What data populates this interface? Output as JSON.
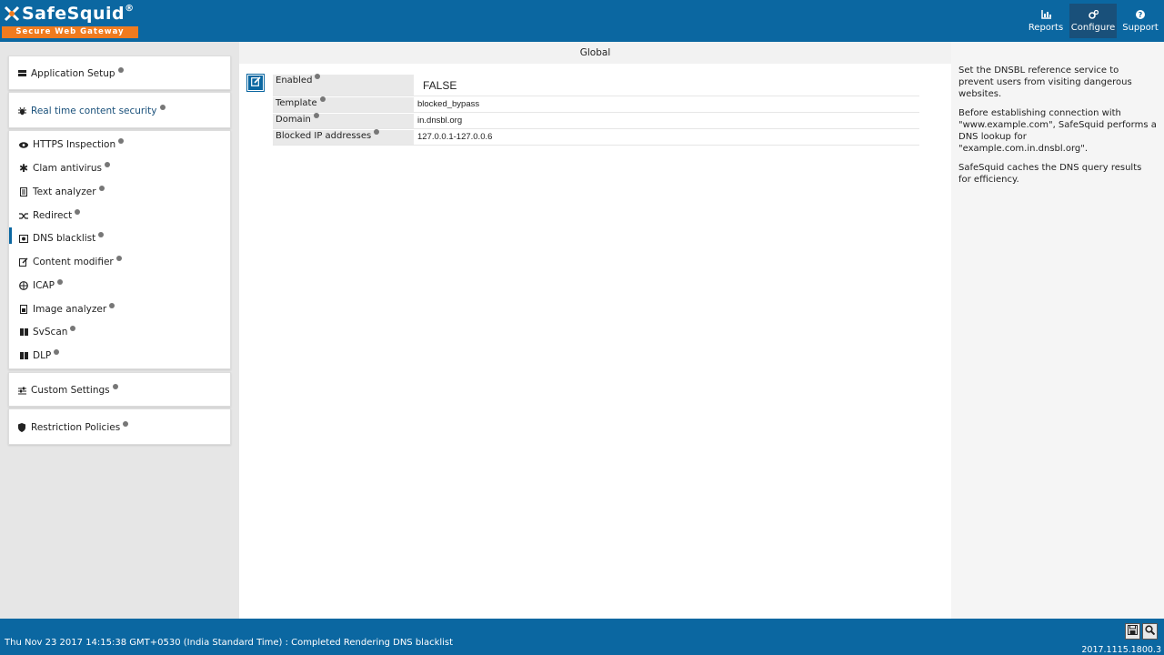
{
  "brand": {
    "name": "SafeSquid",
    "registered": "®",
    "tagline": "Secure Web Gateway",
    "accent_orange": "#f07b1f",
    "primary_blue": "#0b67a1"
  },
  "top_nav": [
    {
      "label": "Reports",
      "icon": "chart-icon"
    },
    {
      "label": "Configure",
      "icon": "gears-icon",
      "active": true
    },
    {
      "label": "Support",
      "icon": "help-icon"
    }
  ],
  "sidebar": {
    "application_setup": "Application Setup",
    "real_time": "Real time content security",
    "items": [
      {
        "label": "HTTPS Inspection",
        "icon": "eye-icon"
      },
      {
        "label": "Clam antivirus",
        "icon": "asterisk-icon"
      },
      {
        "label": "Text analyzer",
        "icon": "document-icon"
      },
      {
        "label": "Redirect",
        "icon": "shuffle-icon"
      },
      {
        "label": "DNS blacklist",
        "icon": "dns-icon",
        "selected": true
      },
      {
        "label": "Content modifier",
        "icon": "edit-icon"
      },
      {
        "label": "ICAP",
        "icon": "globe-icon"
      },
      {
        "label": "Image analyzer",
        "icon": "image-file-icon"
      },
      {
        "label": "SvScan",
        "icon": "columns-icon"
      },
      {
        "label": "DLP",
        "icon": "columns-icon"
      }
    ],
    "custom_settings": "Custom Settings",
    "restriction_policies": "Restriction Policies"
  },
  "main": {
    "title": "Global",
    "fields": [
      {
        "label": "Enabled",
        "value": "FALSE"
      },
      {
        "label": "Template",
        "value": "blocked_bypass"
      },
      {
        "label": "Domain",
        "value": "in.dnsbl.org"
      },
      {
        "label": "Blocked IP addresses",
        "value": "127.0.0.1-127.0.0.6"
      }
    ]
  },
  "help": {
    "p1": "Set the DNSBL reference service to prevent users from visiting dangerous websites.",
    "p2": "Before establishing connection with \"www.example.com\", SafeSquid performs a DNS lookup for \"example.com.in.dnsbl.org\".",
    "p3": "SafeSquid caches the DNS query results for efficiency."
  },
  "footer": {
    "status": "Thu Nov 23 2017 14:15:38 GMT+0530 (India Standard Time) : Completed Rendering DNS blacklist",
    "version": "2017.1115.1800.3"
  }
}
